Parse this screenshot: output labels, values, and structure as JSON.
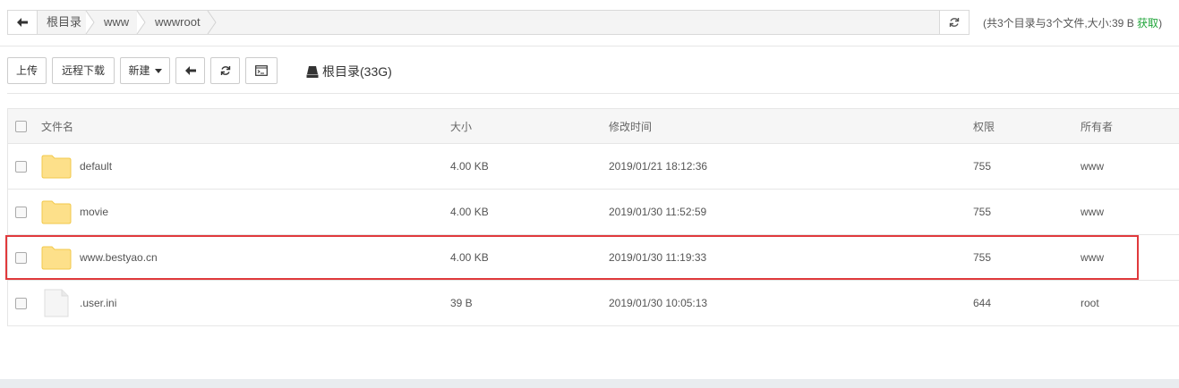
{
  "pathbar": {
    "crumbs": [
      "根目录",
      "www",
      "wwwroot"
    ]
  },
  "summary": {
    "text": "(共3个目录与3个文件,大小:39 B",
    "fetch_label": "获取",
    "close": ")"
  },
  "toolbar": {
    "upload_label": "上传",
    "remote_download_label": "远程下载",
    "new_label": "新建",
    "disk_label": "根目录(33G)"
  },
  "table": {
    "columns": [
      "文件名",
      "大小",
      "修改时间",
      "权限",
      "所有者"
    ],
    "rows": [
      {
        "type": "folder",
        "name": "default",
        "size": "4.00 KB",
        "mtime": "2019/01/21 18:12:36",
        "perm": "755",
        "owner": "www",
        "highlighted": false
      },
      {
        "type": "folder",
        "name": "movie",
        "size": "4.00 KB",
        "mtime": "2019/01/30 11:52:59",
        "perm": "755",
        "owner": "www",
        "highlighted": false
      },
      {
        "type": "folder",
        "name": "www.bestyao.cn",
        "size": "4.00 KB",
        "mtime": "2019/01/30 11:19:33",
        "perm": "755",
        "owner": "www",
        "highlighted": true
      },
      {
        "type": "file",
        "name": ".user.ini",
        "size": "39 B",
        "mtime": "2019/01/30 10:05:13",
        "perm": "644",
        "owner": "root",
        "highlighted": false
      }
    ]
  },
  "colors": {
    "folder": "#fde08a",
    "folder_border": "#f2c94c",
    "highlight": "#e0393c",
    "accent": "#20a53a"
  }
}
